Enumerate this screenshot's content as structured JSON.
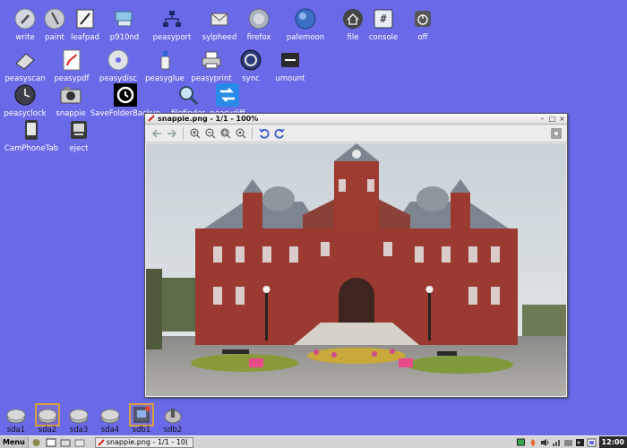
{
  "desktop": {
    "background": "#6a6ae8",
    "row1": [
      {
        "label": "write",
        "icon": "write-icon"
      },
      {
        "label": "paint",
        "icon": "paint-icon"
      },
      {
        "label": "leafpad",
        "icon": "leafpad-icon"
      },
      {
        "label": "p910nd",
        "icon": "printer-server-icon"
      },
      {
        "label": "peasyport",
        "icon": "network-icon"
      },
      {
        "label": "sylpheed",
        "icon": "mail-icon"
      },
      {
        "label": "firefox",
        "icon": "firefox-icon"
      },
      {
        "label": "palemoon",
        "icon": "palemoon-icon"
      },
      {
        "label": "file",
        "icon": "home-icon"
      },
      {
        "label": "console",
        "icon": "console-icon"
      },
      {
        "label": "off",
        "icon": "power-icon"
      }
    ],
    "row2": [
      {
        "label": "peasyscan",
        "icon": "scanner-icon"
      },
      {
        "label": "peasypdf",
        "icon": "pdf-icon"
      },
      {
        "label": "peasydisc",
        "icon": "disc-icon"
      },
      {
        "label": "peasyglue",
        "icon": "glue-icon"
      },
      {
        "label": "peasyprint",
        "icon": "printer-icon"
      },
      {
        "label": "sync",
        "icon": "sync-icon"
      },
      {
        "label": "umount",
        "icon": "eject-drive-icon"
      }
    ],
    "row3": [
      {
        "label": "peasyclock",
        "icon": "clock-icon"
      },
      {
        "label": "snappie",
        "icon": "camera-icon"
      },
      {
        "label": "SaveFolderBackup",
        "icon": "backup-icon"
      },
      {
        "label": "filefinder",
        "icon": "magnifier-icon"
      },
      {
        "label": "peasydiff",
        "icon": "diff-icon"
      }
    ],
    "row4": [
      {
        "label": "CamPhoneTab",
        "icon": "phone-icon"
      },
      {
        "label": "eject",
        "icon": "eject-icon"
      }
    ],
    "drives": [
      {
        "label": "sda1"
      },
      {
        "label": "sda2"
      },
      {
        "label": "sda3"
      },
      {
        "label": "sda4"
      },
      {
        "label": "sdb1"
      },
      {
        "label": "sdb2"
      }
    ]
  },
  "viewer": {
    "title": "snappie.png - 1/1 - 100%",
    "buttons": {
      "minimize": "–",
      "maximize": "□",
      "close": "×"
    },
    "toolbar": [
      "back",
      "forward",
      "zoom-in",
      "zoom-out",
      "zoom-fit",
      "zoom-100",
      "rotate-left",
      "rotate-right",
      "fullscreen"
    ]
  },
  "taskbar": {
    "menu_label": "Menu",
    "task_label": "snappie.png - 1/1 - 10(",
    "clock": "12:00"
  }
}
